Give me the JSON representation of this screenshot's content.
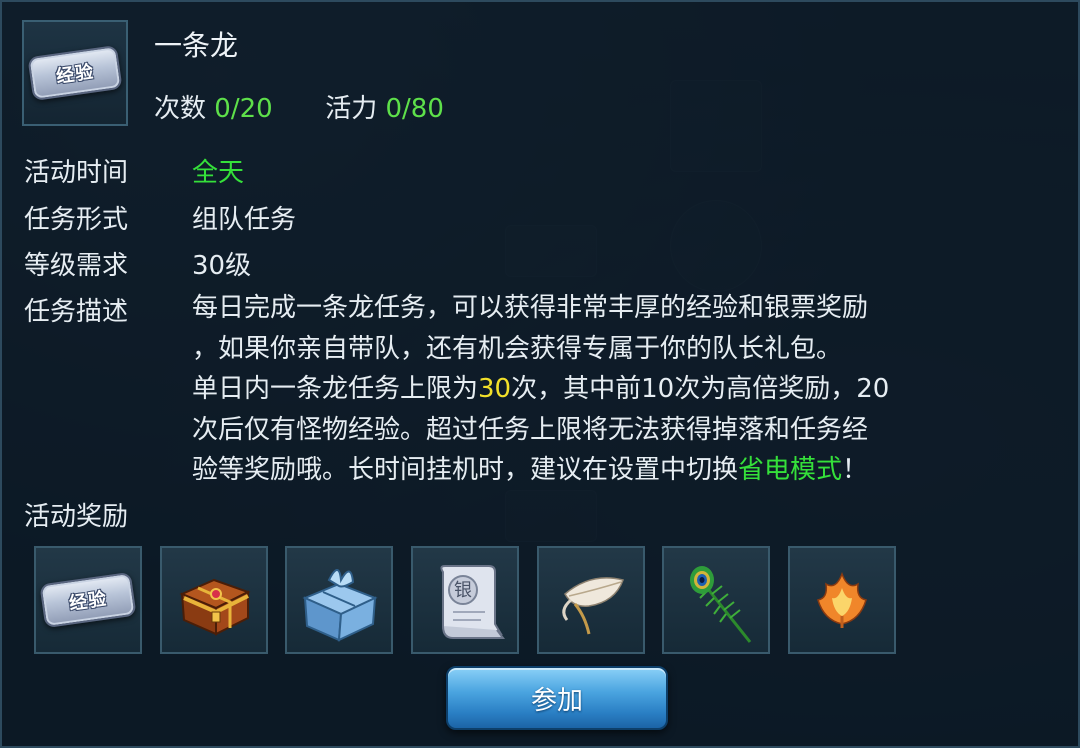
{
  "header": {
    "icon": "exp-ticket-icon",
    "icon_text": "经验",
    "title": "一条龙",
    "count_label": "次数",
    "count_value": "0/20",
    "vitality_label": "活力",
    "vitality_value": "0/80"
  },
  "info": {
    "time_label": "活动时间",
    "time_value": "全天",
    "form_label": "任务形式",
    "form_value": "组队任务",
    "level_label": "等级需求",
    "level_value": "30级",
    "desc_label": "任务描述",
    "desc_line1": "每日完成一条龙任务，可以获得非常丰厚的经验和银票奖励",
    "desc_line2": "，如果你亲自带队，还有机会获得专属于你的队长礼包。",
    "desc_line3_a": "单日内一条龙任务上限为",
    "desc_line3_b": "30",
    "desc_line3_c": "次，其中前10次为高倍奖励，20",
    "desc_line4": "次后仅有怪物经验。超过任务上限将无法获得掉落和任务经",
    "desc_line5_a": "验等奖励哦。长时间挂机时，建议在设置中切换",
    "desc_line5_b": "省电模式",
    "desc_line5_c": "！"
  },
  "rewards": {
    "label": "活动奖励",
    "items": [
      {
        "icon": "exp-ticket-icon",
        "text": "经验"
      },
      {
        "icon": "treasure-chest-icon"
      },
      {
        "icon": "blue-gift-bundle-icon"
      },
      {
        "icon": "silver-note-scroll-icon",
        "text": "银"
      },
      {
        "icon": "white-feather-icon"
      },
      {
        "icon": "peacock-feather-icon"
      },
      {
        "icon": "fire-feather-icon"
      }
    ]
  },
  "actions": {
    "join_label": "参加"
  },
  "colors": {
    "value_green": "#35e03a",
    "highlight_yellow": "#f2e02a",
    "button_blue": "#3b94d6"
  }
}
